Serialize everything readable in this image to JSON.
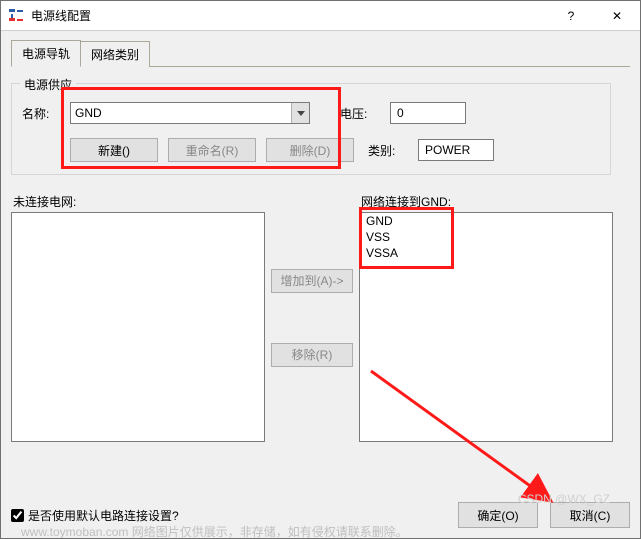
{
  "window": {
    "title": "电源线配置",
    "help_icon": "?",
    "close_icon": "✕"
  },
  "tabs": [
    {
      "label": "电源导轨",
      "active": true
    },
    {
      "label": "网络类别",
      "active": false
    }
  ],
  "supply": {
    "legend": "电源供应",
    "name_label": "名称:",
    "name_value": "GND",
    "voltage_label": "电压:",
    "voltage_value": "0",
    "category_label": "类别:",
    "category_value": "POWER",
    "new_btn": "新建()",
    "rename_btn": "重命名(R)",
    "delete_btn": "删除(D)"
  },
  "lists": {
    "left_label": "未连接电网:",
    "right_prefix": "网络连接到",
    "right_target": "GND",
    "add_btn": "增加到(A)->",
    "remove_btn": "移除(R)",
    "connected": [
      "GND",
      "VSS",
      "VSSA"
    ]
  },
  "footer": {
    "checkbox_label": "是否使用默认电路连接设置?",
    "ok_btn": "确定(O)",
    "cancel_btn": "取消(C)"
  },
  "watermark": {
    "left": "www.toymoban.com  网络图片仅供展示，非存储，如有侵权请联系删除。",
    "right": "CSDN @WX_GZ"
  }
}
